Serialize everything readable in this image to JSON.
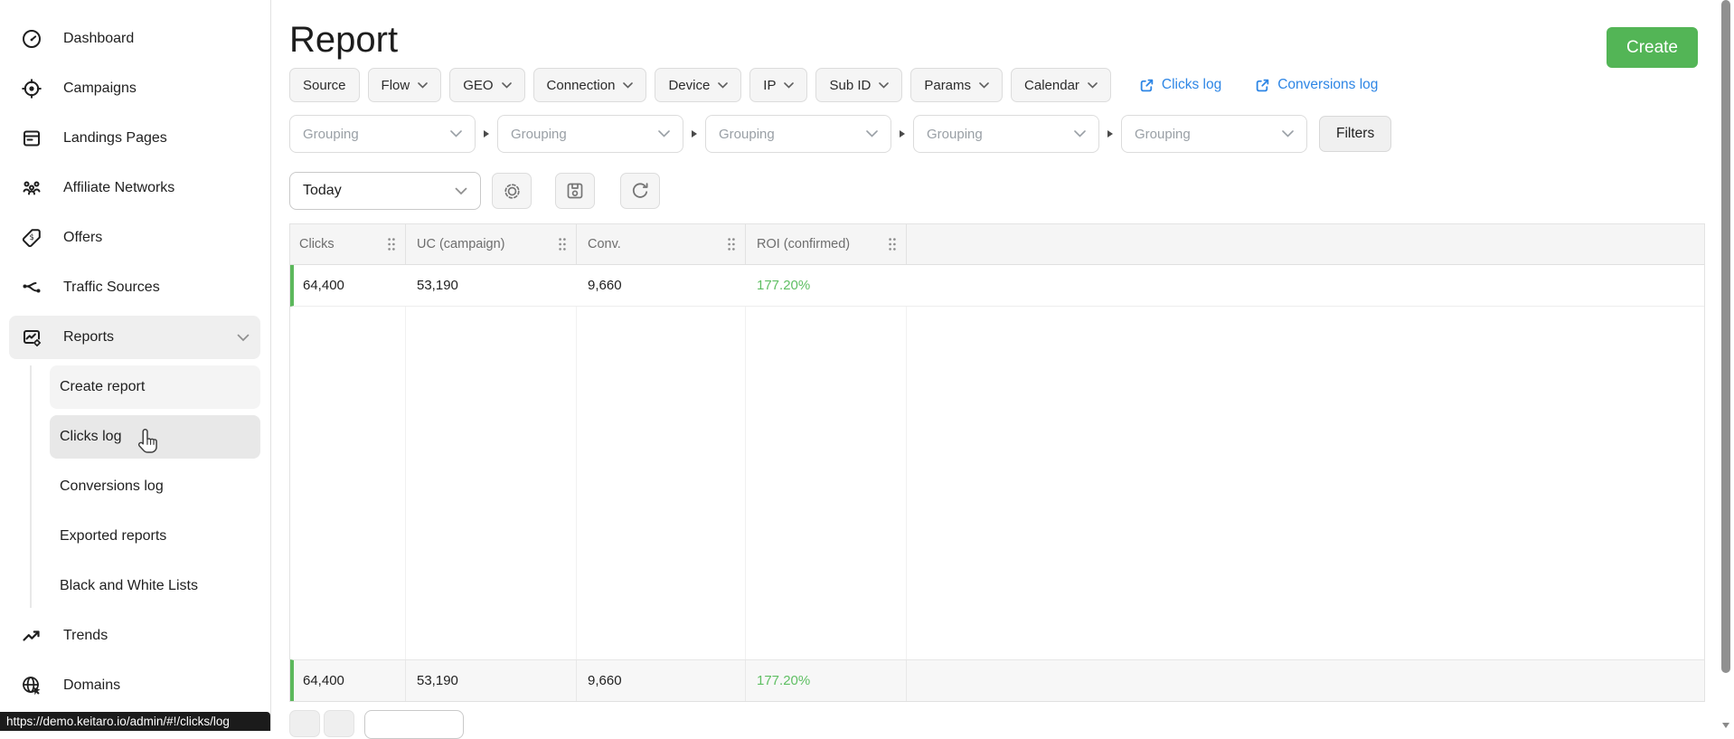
{
  "colors": {
    "accent_green": "#53b556",
    "row_border_green": "#5cb85c",
    "roi_green": "#5fbf63",
    "link_blue": "#2e86e5"
  },
  "sidebar": {
    "items": [
      {
        "label": "Dashboard",
        "icon": "dashboard-icon"
      },
      {
        "label": "Campaigns",
        "icon": "campaigns-icon"
      },
      {
        "label": "Landings Pages",
        "icon": "landing-pages-icon"
      },
      {
        "label": "Affiliate Networks",
        "icon": "affiliate-networks-icon"
      },
      {
        "label": "Offers",
        "icon": "offers-icon"
      },
      {
        "label": "Traffic Sources",
        "icon": "traffic-sources-icon"
      },
      {
        "label": "Reports",
        "icon": "reports-icon",
        "expanded": true,
        "active": true
      },
      {
        "label": "Trends",
        "icon": "trends-icon"
      },
      {
        "label": "Domains",
        "icon": "domains-icon"
      }
    ],
    "reports_subitems": [
      {
        "label": "Create report",
        "state": "selected"
      },
      {
        "label": "Clicks log",
        "state": "hovered"
      },
      {
        "label": "Conversions log",
        "state": "normal"
      },
      {
        "label": "Exported reports",
        "state": "normal"
      },
      {
        "label": "Black and White Lists",
        "state": "normal"
      }
    ]
  },
  "header": {
    "title": "Report",
    "create_label": "Create"
  },
  "filters": {
    "chips": [
      {
        "label": "Source",
        "caret": false
      },
      {
        "label": "Flow",
        "caret": true
      },
      {
        "label": "GEO",
        "caret": true
      },
      {
        "label": "Connection",
        "caret": true
      },
      {
        "label": "Device",
        "caret": true
      },
      {
        "label": "IP",
        "caret": true
      },
      {
        "label": "Sub ID",
        "caret": true
      },
      {
        "label": "Params",
        "caret": true
      },
      {
        "label": "Calendar",
        "caret": true
      }
    ],
    "links": [
      {
        "label": "Clicks log"
      },
      {
        "label": "Conversions log"
      }
    ]
  },
  "grouping": {
    "placeholder": "Grouping",
    "count": 5,
    "filters_label": "Filters"
  },
  "toolbar": {
    "date_range": "Today",
    "icons": [
      "gear-icon",
      "save-icon",
      "refresh-icon"
    ]
  },
  "table": {
    "columns": [
      "Clicks",
      "UC (campaign)",
      "Conv.",
      "ROI (confirmed)"
    ],
    "rows": [
      [
        "64,400",
        "53,190",
        "9,660",
        "177.20%"
      ]
    ],
    "footer": [
      "64,400",
      "53,190",
      "9,660",
      "177.20%"
    ]
  },
  "status_bar": {
    "url": "https://demo.keitaro.io/admin/#!/clicks/log"
  }
}
